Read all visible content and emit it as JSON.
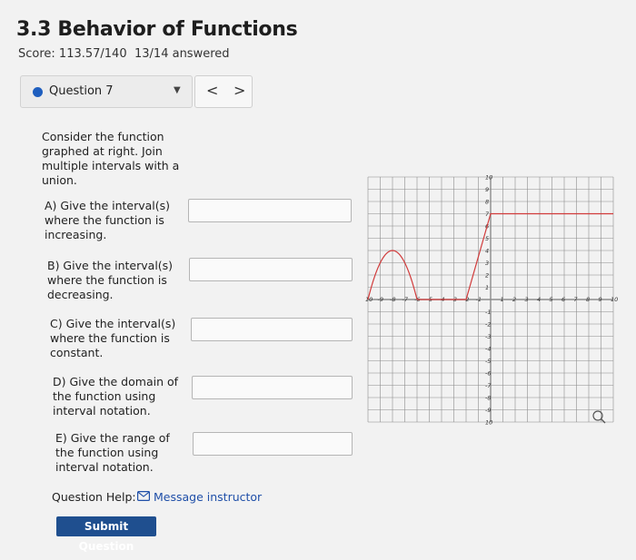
{
  "header": {
    "title": "3.3 Behavior of Functions",
    "score": "Score: 113.57/140",
    "answered": "13/14 answered"
  },
  "question_nav": {
    "label": "Question 7",
    "prev": "<",
    "next": ">"
  },
  "question": {
    "intro": "Consider the function graphed at right. Join multiple intervals with a union.",
    "parts": [
      {
        "text": "A) Give the interval(s) where the function is increasing.",
        "value": ""
      },
      {
        "text": "B) Give the interval(s) where the function is decreasing.",
        "value": ""
      },
      {
        "text": "C) Give the interval(s) where the function is constant.",
        "value": ""
      },
      {
        "text": "D) Give the domain of the function using interval notation.",
        "value": ""
      },
      {
        "text": "E) Give the range of the function using interval notation.",
        "value": ""
      }
    ]
  },
  "footer": {
    "help_label": "Question Help:",
    "message_label": "Message instructor",
    "submit_label": "Submit Question"
  },
  "graph": {
    "x_ticks": [
      "10",
      "-9",
      "-8",
      "-7",
      "-6",
      "-5",
      "-4",
      "-3",
      "-2",
      "-1",
      "1",
      "2",
      "3",
      "4",
      "5",
      "6",
      "7",
      "8",
      "9",
      "10"
    ],
    "y_ticks": [
      "10",
      "9",
      "8",
      "7",
      "6",
      "5",
      "4",
      "3",
      "2",
      "1",
      "-1",
      "-2",
      "-3",
      "-4",
      "-5",
      "-6",
      "-7",
      "-8",
      "-9",
      "10"
    ],
    "curve_color": "#d13b3b",
    "grid_color": "#8c8c8c",
    "zoom_icon": "magnifier-icon"
  }
}
